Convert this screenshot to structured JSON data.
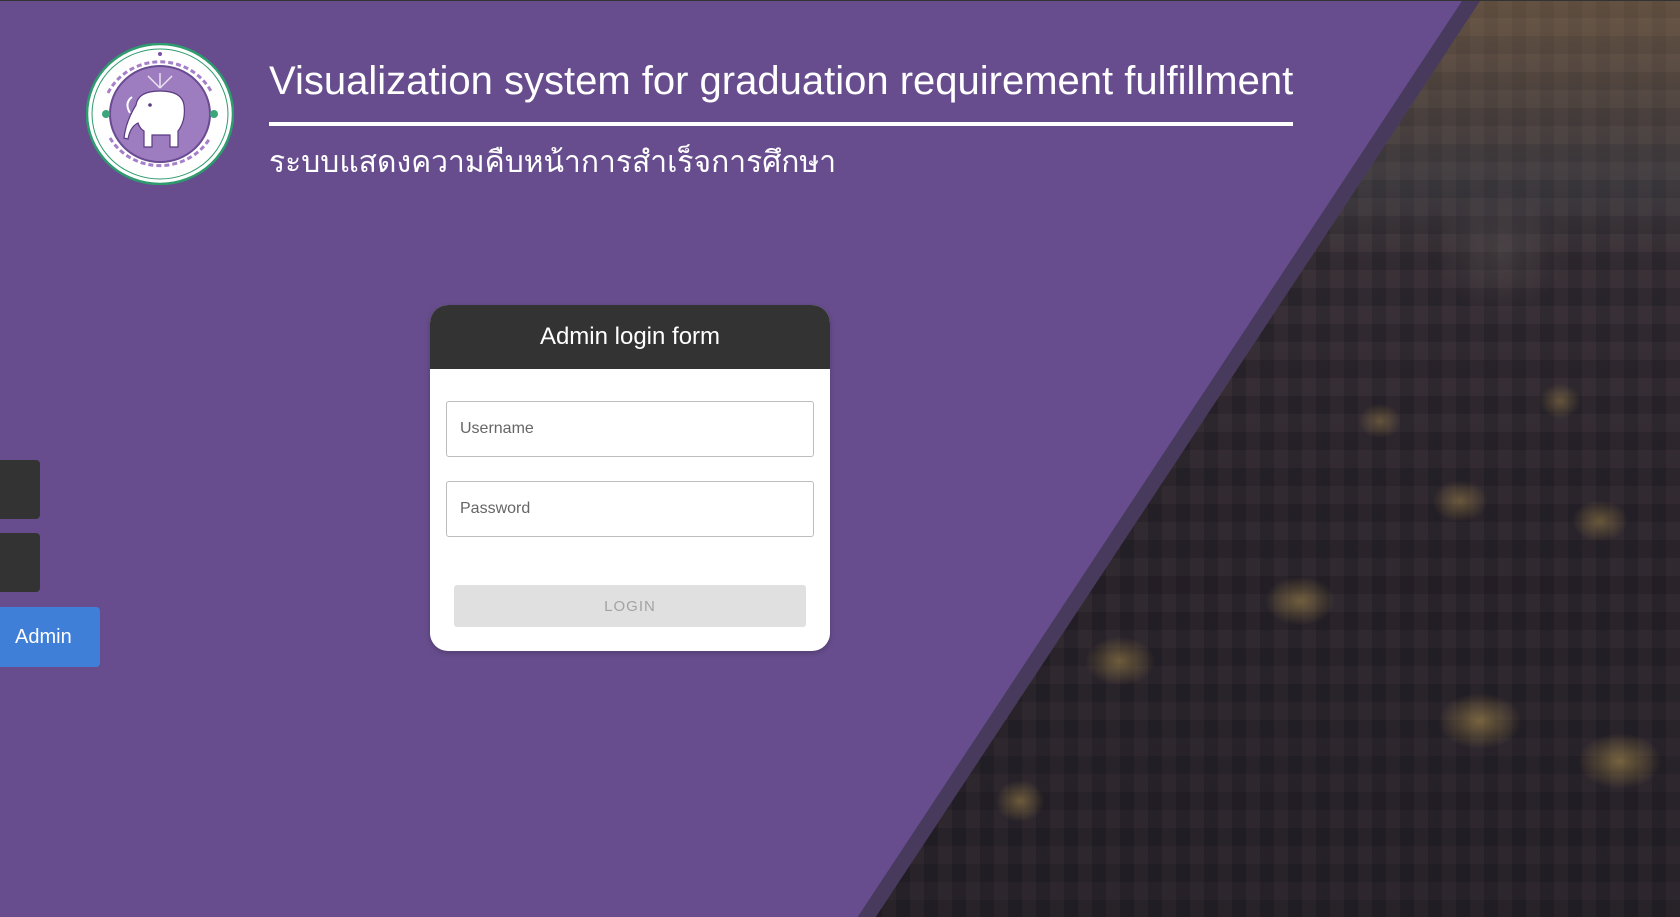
{
  "header": {
    "title": "Visualization system for graduation requirement fulfillment",
    "subtitle": "ระบบแสดงความคืบหน้าการสำเร็จการศึกษา"
  },
  "sidebar": {
    "admin_label": "Admin"
  },
  "login_form": {
    "title": "Admin login form",
    "username_placeholder": "Username",
    "password_placeholder": "Password",
    "login_label": "LOGIN"
  },
  "colors": {
    "background": "#674d8d",
    "card_header": "#333333",
    "admin_tab": "#3f7fd8"
  },
  "icons": {
    "logo": "university-seal-elephant-icon"
  }
}
